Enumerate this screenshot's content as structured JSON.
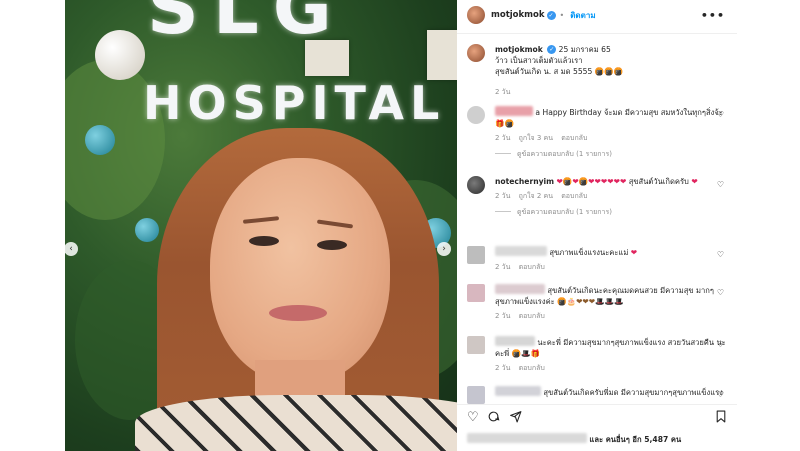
{
  "post": {
    "username": "motjokmok",
    "follow_label": "ติดตาม",
    "more_label": "•••",
    "caption": {
      "username": "motjokmok",
      "date": "25 มกราคม 65",
      "line1": "ว้าว เป็นสาวเต็มตัวแล้วเรา",
      "line2": "สุขสันต์วันเกิด น. ส มด 5555",
      "emoji": "🍘🍘🍘",
      "time": "2 วัน"
    },
    "photo_sign_top": "SLG",
    "photo_sign_bottom": "HOSPITAL",
    "prev_arrow": "‹",
    "next_arrow": "›"
  },
  "comments": [
    {
      "text": "a Happy Birthday จ้ะมด มีความสุข สมหวังในทุกๆสิ่งจ้ะ",
      "emoji": "🎁🍘",
      "meta": [
        "2 วัน",
        "ถูกใจ 3 คน",
        "ตอบกลับ"
      ],
      "replies": "ดูข้อความตอบกลับ (1 รายการ)"
    },
    {
      "username": "notechernyim",
      "text": "สุขสันต์วันเกิดครับ",
      "emoji": "❤🍘❤🍘❤❤❤❤❤❤",
      "emoji_end": "❤",
      "meta": [
        "2 วัน",
        "ถูกใจ 2 คน",
        "ตอบกลับ"
      ],
      "replies": "ดูข้อความตอบกลับ (1 รายการ)"
    },
    {
      "text": "สุขภาพแข็งแรงนะคะแม่",
      "emoji": "❤",
      "meta": [
        "2 วัน",
        "ตอบกลับ"
      ]
    },
    {
      "text": "สุขสันต์วันเกิดนะคะคุณมดคนสวย มีความสุข มากๆ สุขภาพแข็งแรงค่ะ",
      "emoji": "🍘🎂❤❤❤🎩🎩🎩",
      "meta": [
        "2 วัน",
        "ตอบกลับ"
      ]
    },
    {
      "text": "นะคะพี่ มีความสุขมากๆสุขภาพแข็งแรง สวยวันสวยคืน นะคะพี่",
      "emoji": "🍘🎩🎁",
      "meta": [
        "2 วัน",
        "ตอบกลับ"
      ]
    },
    {
      "text": "สุขสันต์วันเกิดครับพี่มด มีความสุขมากๆสุขภาพแข็งแรง"
    }
  ],
  "likes_text": "และ คนอื่นๆ อีก 5,487 คน",
  "colors": {
    "verified": "#3897f0",
    "follow": "#0095f6",
    "heart": "#e0245e"
  },
  "icons": [
    "heart-icon",
    "comment-icon",
    "share-icon",
    "bookmark-icon",
    "more-icon",
    "verified-icon"
  ]
}
